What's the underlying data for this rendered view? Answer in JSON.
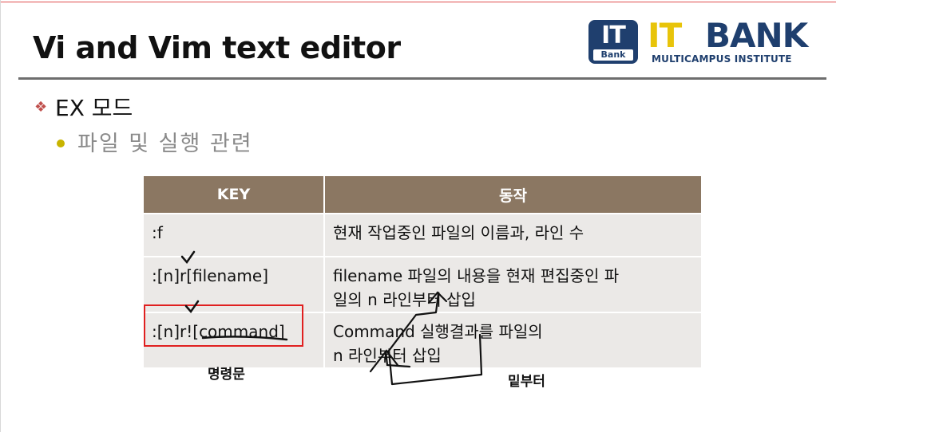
{
  "title": "Vi and Vim text editor",
  "logo": {
    "badge_top": "IT",
    "badge_bottom": "Bank",
    "name_part1": "IT",
    "name_part2": "BANK",
    "subtitle": "MULTICAMPUS INSTITUTE"
  },
  "bullets": {
    "level1": "EX 모드",
    "level2": "파일 및 실행 관련"
  },
  "table": {
    "headers": [
      "KEY",
      "동작"
    ],
    "rows": [
      {
        "key": ":f",
        "action_line1": "현재 작업중인 파일의 이름과, 라인 수",
        "action_line2": ""
      },
      {
        "key": ":[n]r[filename]",
        "action_line1": "filename 파일의 내용을 현재 편집중인 파",
        "action_line2": "일의 n 라인부터 삽입"
      },
      {
        "key": ":[n]r![command]",
        "action_line1": "Command 실행결과를 파일의",
        "action_line2": "n 라인부터 삽입"
      }
    ]
  },
  "annotations": {
    "left_caption": "명령문",
    "right_caption": "밑부터"
  },
  "colors": {
    "header_bg": "#8b7762",
    "cell_bg": "#ebe9e7",
    "logo_blue": "#1f3f6e",
    "logo_yellow": "#e8c40a",
    "highlight_red": "#e02020"
  }
}
